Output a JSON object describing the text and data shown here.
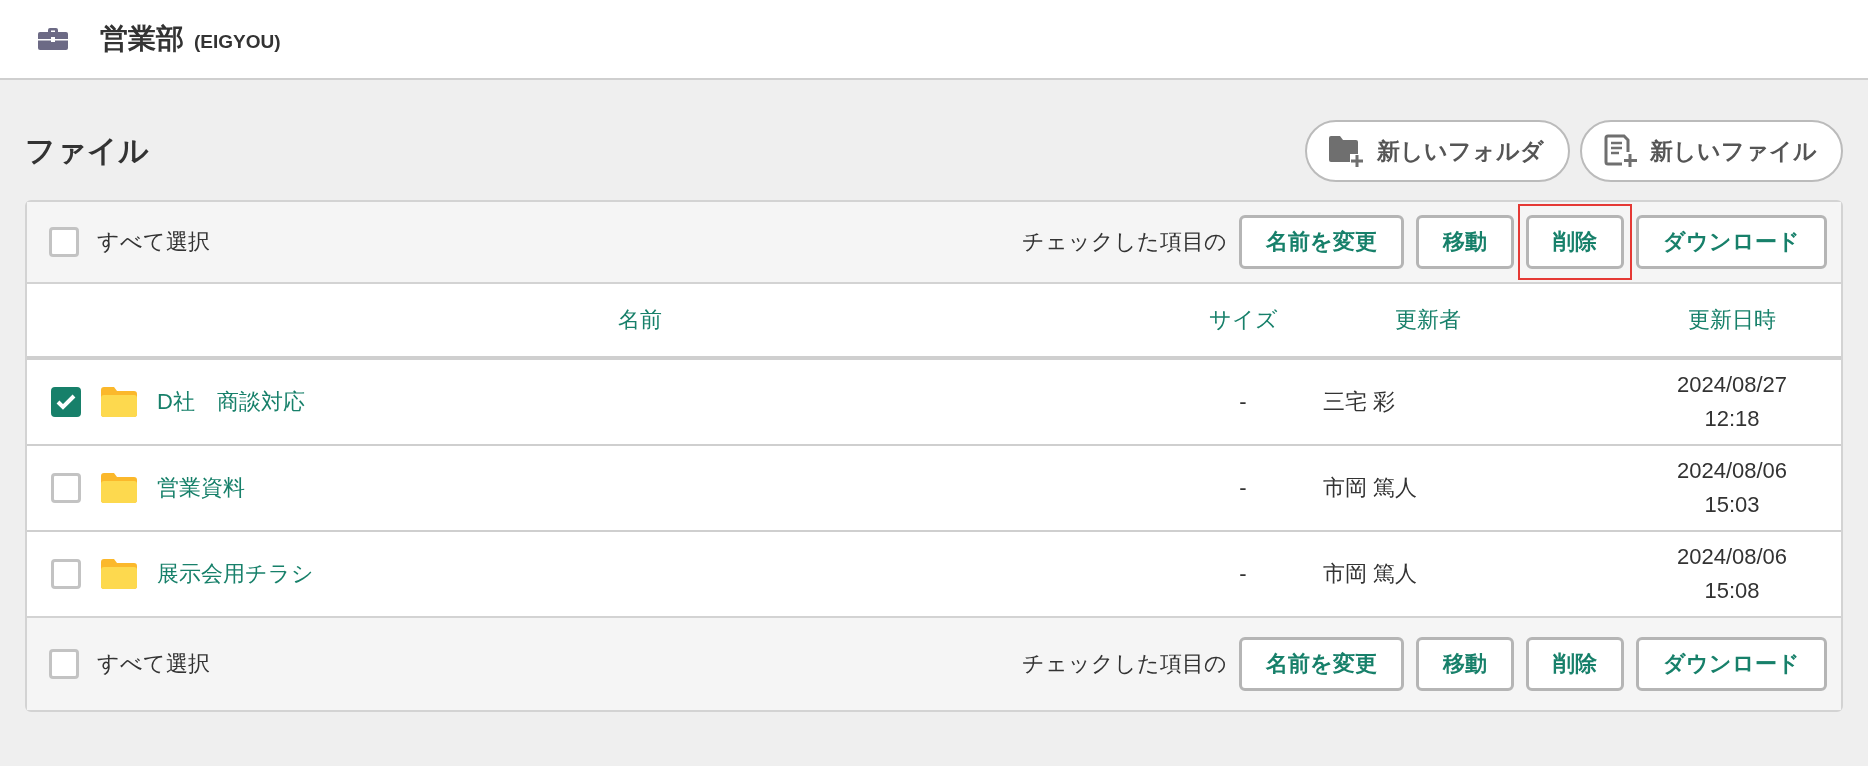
{
  "header": {
    "title": "営業部",
    "code": "(EIGYOU)"
  },
  "section_title": "ファイル",
  "actions": [
    {
      "kind": "folder",
      "label": "新しいフォルダ"
    },
    {
      "kind": "file",
      "label": "新しいファイル"
    }
  ],
  "top_toolbar": {
    "select_all": {
      "label": "すべて選択",
      "checked": false
    },
    "bulk_label": "チェックした項目の",
    "buttons": [
      {
        "label": "名前を変更",
        "highlighted": false
      },
      {
        "label": "移動",
        "highlighted": false
      },
      {
        "label": "削除",
        "highlighted": true
      },
      {
        "label": "ダウンロード",
        "highlighted": false
      }
    ]
  },
  "columns": [
    "名前",
    "サイズ",
    "更新者",
    "更新日時"
  ],
  "rows": [
    {
      "checked": true,
      "name": "D社　商談対応",
      "size": "-",
      "updated_by": "三宅 彩",
      "updated_at": "2024/08/27 12:18"
    },
    {
      "checked": false,
      "name": "営業資料",
      "size": "-",
      "updated_by": "市岡 篤人",
      "updated_at": "2024/08/06 15:03"
    },
    {
      "checked": false,
      "name": "展示会用チラシ",
      "size": "-",
      "updated_by": "市岡 篤人",
      "updated_at": "2024/08/06 15:08"
    }
  ],
  "bottom_toolbar": {
    "select_all": {
      "label": "すべて選択",
      "checked": false
    },
    "bulk_label": "チェックした項目の",
    "buttons": [
      {
        "label": "名前を変更",
        "highlighted": false
      },
      {
        "label": "移動",
        "highlighted": false
      },
      {
        "label": "削除",
        "highlighted": false
      },
      {
        "label": "ダウンロード",
        "highlighted": false
      }
    ]
  }
}
